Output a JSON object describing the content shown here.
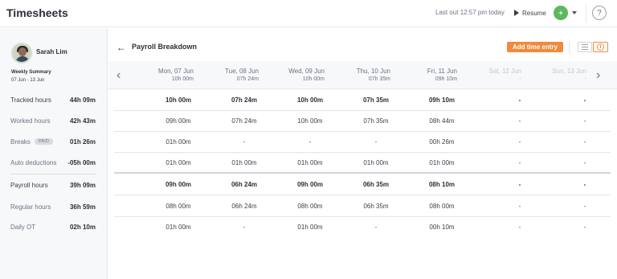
{
  "app": {
    "title": "Timesheets"
  },
  "topbar": {
    "last_out": "Last out 12:57 pm today",
    "resume_label": "Resume",
    "status_icon": "+",
    "help_icon": "?"
  },
  "user": {
    "name": "Sarah Lim",
    "weekly_label": "Weekly Summary",
    "range": "07 Jun - 13 Jun"
  },
  "summary": [
    {
      "label": "Tracked hours",
      "value": "44h 09m",
      "badge": ""
    },
    {
      "label": "Worked hours",
      "value": "42h 43m",
      "badge": ""
    },
    {
      "label": "Breaks",
      "value": "01h 26m",
      "badge": "PAID"
    },
    {
      "label": "Auto deductions",
      "value": "-05h 00m",
      "badge": ""
    },
    {
      "label": "Payroll hours",
      "value": "39h 09m",
      "badge": ""
    },
    {
      "label": "Regular hours",
      "value": "36h 59m",
      "badge": ""
    },
    {
      "label": "Daily OT",
      "value": "02h 10m",
      "badge": ""
    }
  ],
  "panel": {
    "title": "Payroll Breakdown",
    "add_button": "Add time entry",
    "back_icon": "←"
  },
  "nav": {
    "prev": "‹",
    "next": "›"
  },
  "days": [
    {
      "name": "Mon, 07 Jun",
      "hours": "10h 00m"
    },
    {
      "name": "Tue, 08 Jun",
      "hours": "07h 24m"
    },
    {
      "name": "Wed, 09 Jun",
      "hours": "10h 00m"
    },
    {
      "name": "Thu, 10 Jun",
      "hours": "07h 35m"
    },
    {
      "name": "Fri, 11 Jun",
      "hours": "09h 10m"
    },
    {
      "name": "Sat, 12 Jun",
      "hours": "-"
    },
    {
      "name": "Sun, 13 Jun",
      "hours": "-"
    }
  ],
  "rows": [
    [
      "10h 00m",
      "07h 24m",
      "10h 00m",
      "07h 35m",
      "09h 10m",
      "-",
      "-"
    ],
    [
      "09h 00m",
      "07h 24m",
      "10h 00m",
      "07h 35m",
      "08h 44m",
      "-",
      "-"
    ],
    [
      "01h 00m",
      "-",
      "-",
      "-",
      "00h 26m",
      "-",
      "-"
    ],
    [
      "01h 00m",
      "01h 00m",
      "01h 00m",
      "01h 00m",
      "01h 00m",
      "-",
      "-"
    ],
    [
      "09h 00m",
      "06h 24m",
      "09h 00m",
      "06h 35m",
      "08h 10m",
      "-",
      "-"
    ],
    [
      "08h 00m",
      "06h 24m",
      "08h 00m",
      "06h 35m",
      "08h 00m",
      "-",
      "-"
    ],
    [
      "01h 00m",
      "-",
      "01h 00m",
      "-",
      "00h 10m",
      "-",
      "-"
    ]
  ]
}
